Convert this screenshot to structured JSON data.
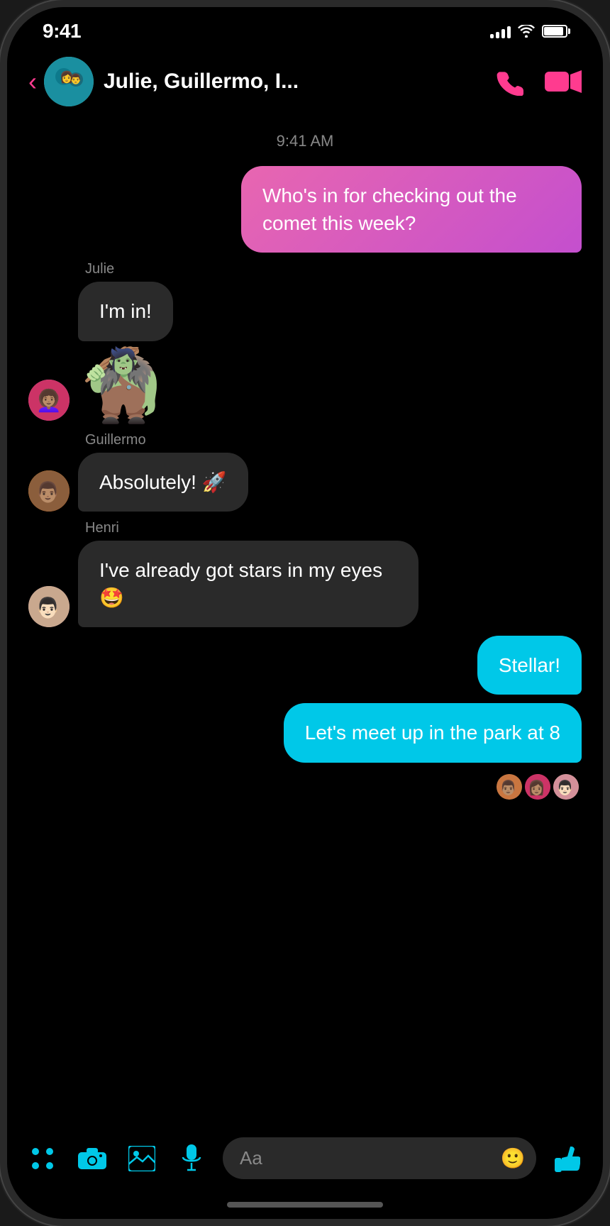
{
  "statusBar": {
    "time": "9:41",
    "signals": [
      4,
      6,
      8,
      10,
      12
    ],
    "wifi": "wifi",
    "battery": 90
  },
  "header": {
    "backLabel": "‹",
    "groupName": "Julie, Guillermo, I...",
    "phoneIcon": "phone",
    "videoIcon": "video"
  },
  "messages": {
    "timestamp": "9:41 AM",
    "outgoing1": {
      "text": "Who's in for checking out the comet this week?",
      "style": "pink"
    },
    "julie": {
      "senderName": "Julie",
      "bubble": "I'm in!",
      "sticker": "🧌"
    },
    "guillermo": {
      "senderName": "Guillermo",
      "bubble": "Absolutely! 🚀"
    },
    "henri": {
      "senderName": "Henri",
      "bubble": "I've already got stars in my eyes 🤩"
    },
    "outgoing2": {
      "text": "Stellar!",
      "style": "cyan"
    },
    "outgoing3": {
      "text": "Let's meet up in the park at 8",
      "style": "cyan"
    }
  },
  "toolbar": {
    "appsLabel": "apps",
    "cameraLabel": "camera",
    "galleryLabel": "gallery",
    "micLabel": "mic",
    "inputPlaceholder": "Aa",
    "emojiLabel": "emoji",
    "thumbsUpLabel": "thumbs-up"
  }
}
